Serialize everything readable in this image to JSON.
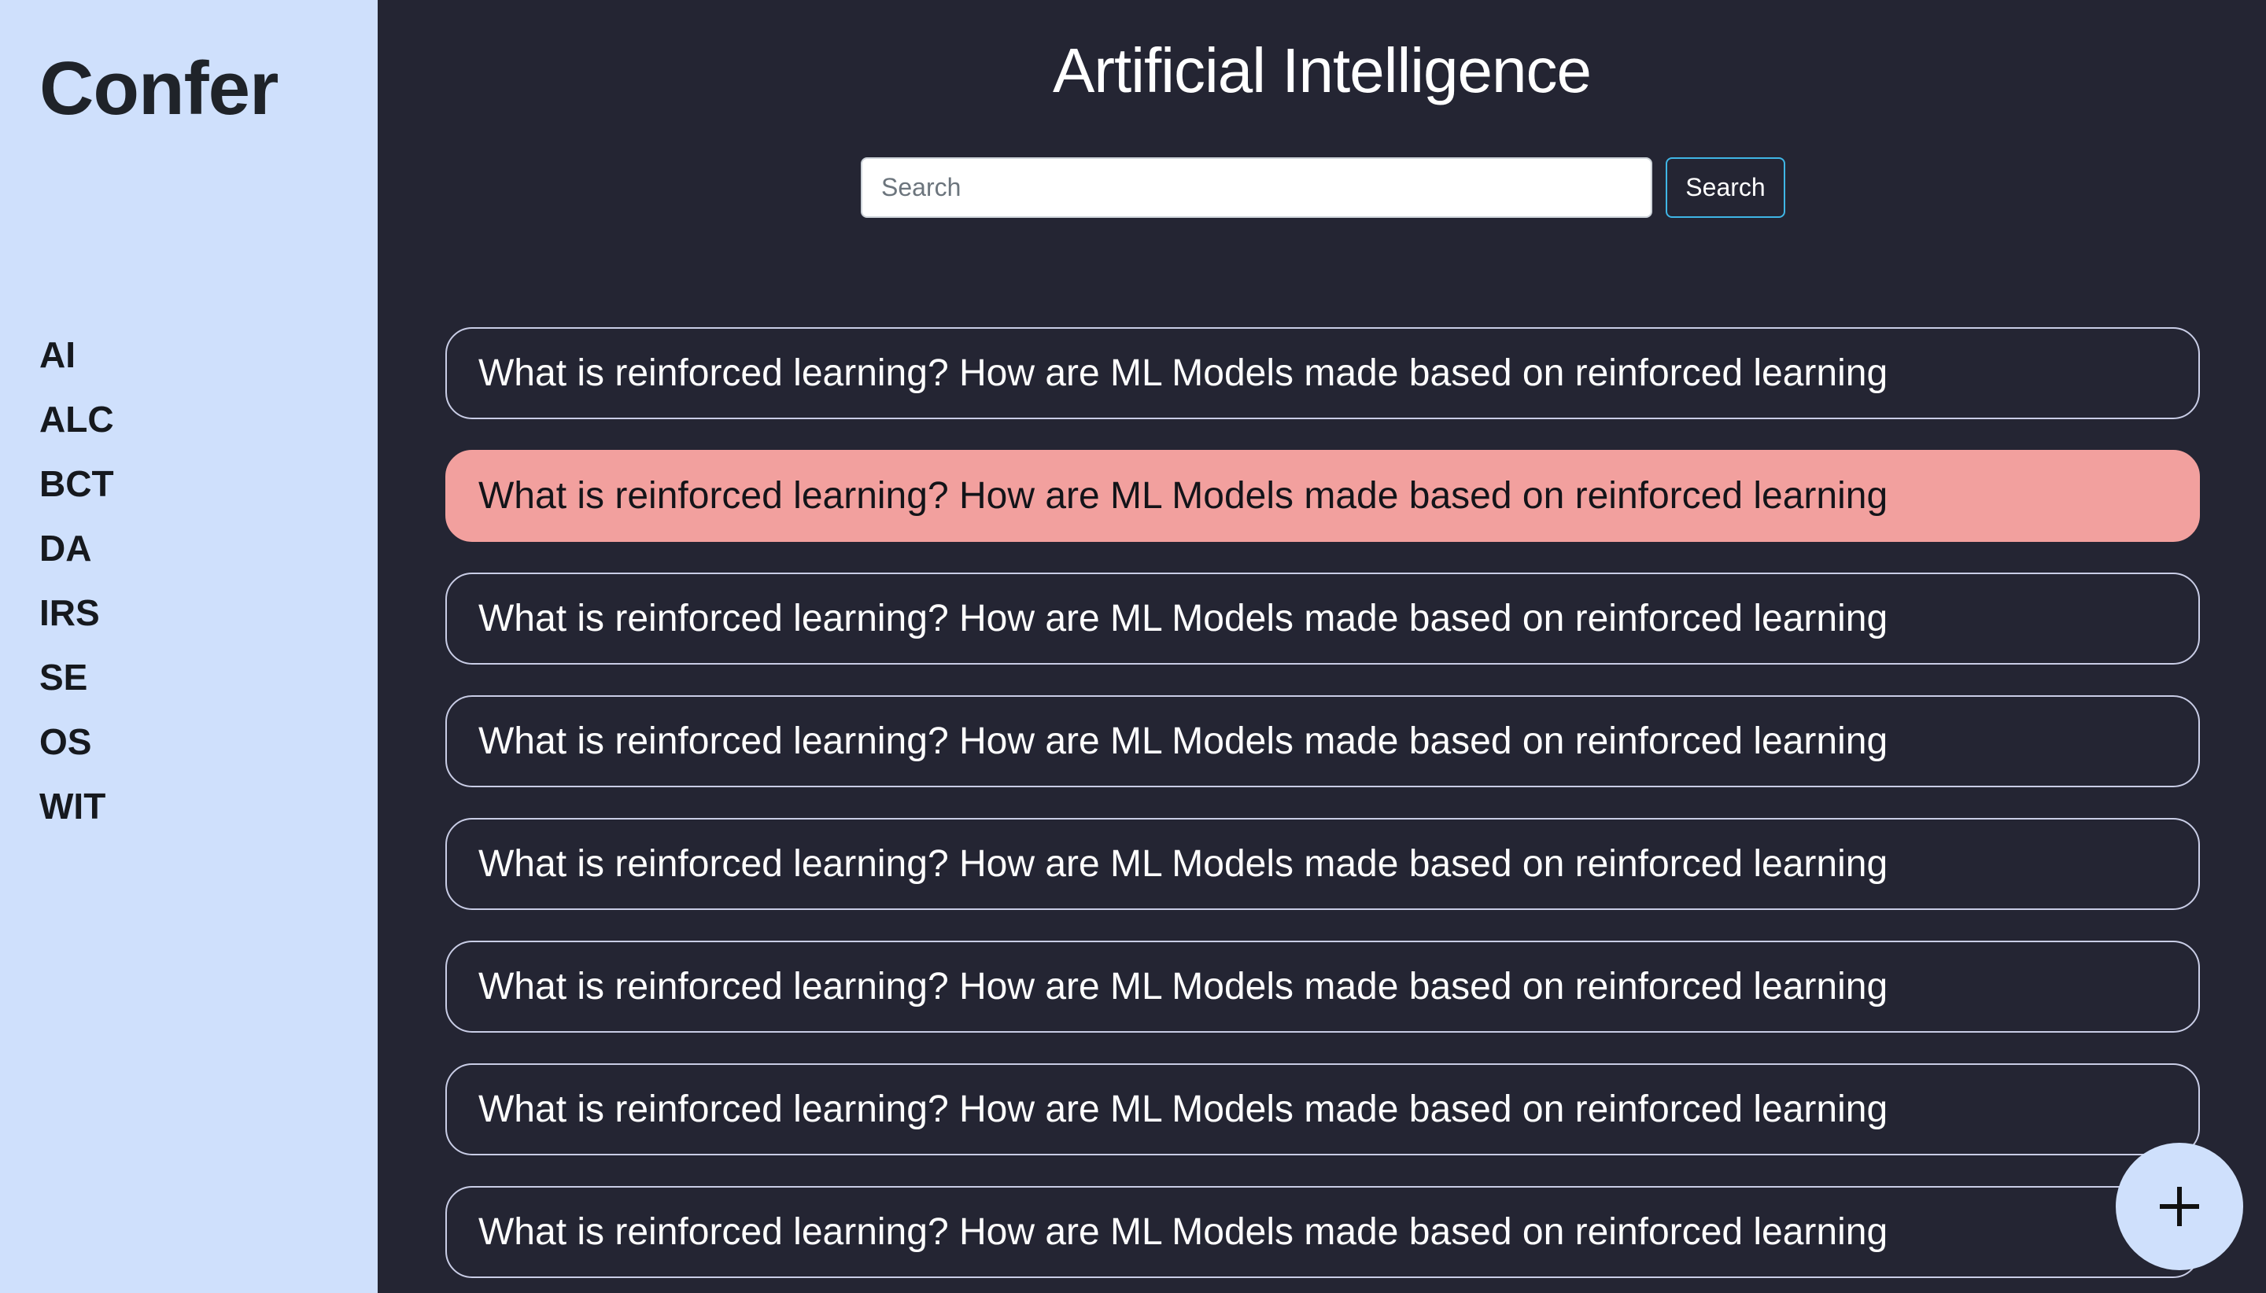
{
  "brand": "Confer",
  "sidebar": {
    "items": [
      {
        "label": "AI"
      },
      {
        "label": "ALC"
      },
      {
        "label": "BCT"
      },
      {
        "label": "DA"
      },
      {
        "label": "IRS"
      },
      {
        "label": "SE"
      },
      {
        "label": "OS"
      },
      {
        "label": "WIT"
      }
    ]
  },
  "main": {
    "title": "Artificial Intelligence",
    "search": {
      "placeholder": "Search",
      "value": "",
      "button_label": "Search"
    },
    "questions": [
      {
        "text": "What is reinforced learning? How are ML Models made based on reinforced learning",
        "highlighted": false
      },
      {
        "text": "What is reinforced learning? How are ML Models made based on reinforced learning",
        "highlighted": true
      },
      {
        "text": "What is reinforced learning? How are ML Models made based on reinforced learning",
        "highlighted": false
      },
      {
        "text": "What is reinforced learning? How are ML Models made based on reinforced learning",
        "highlighted": false
      },
      {
        "text": "What is reinforced learning? How are ML Models made based on reinforced learning",
        "highlighted": false
      },
      {
        "text": "What is reinforced learning? How are ML Models made based on reinforced learning",
        "highlighted": false
      },
      {
        "text": "What is reinforced learning? How are ML Models made based on reinforced learning",
        "highlighted": false
      },
      {
        "text": "What is reinforced learning? How are ML Models made based on reinforced learning",
        "highlighted": false
      }
    ]
  },
  "fab": {
    "icon": "plus-icon"
  },
  "colors": {
    "sidebar_bg": "#cfe0fc",
    "main_bg": "#242533",
    "highlight": "#f2a09e",
    "search_button_border": "#3fb6e6",
    "card_border": "#c9cde6"
  }
}
